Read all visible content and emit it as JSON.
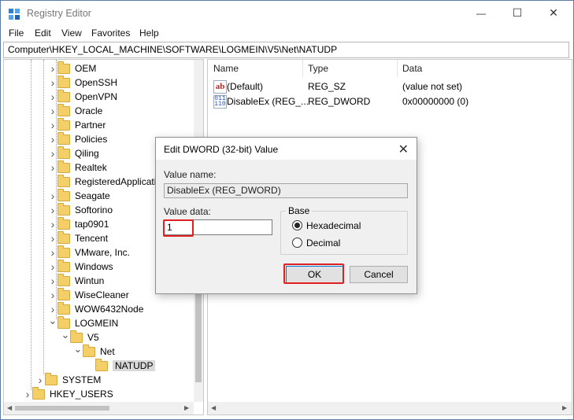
{
  "window": {
    "title": "Registry Editor",
    "icon": "registry-editor-icon",
    "controls": {
      "minimize": "—",
      "maximize": "☐",
      "close": "✕"
    }
  },
  "menu": [
    "File",
    "Edit",
    "View",
    "Favorites",
    "Help"
  ],
  "address": "Computer\\HKEY_LOCAL_MACHINE\\SOFTWARE\\LOGMEIN\\V5\\Net\\NATUDP",
  "tree": {
    "items": [
      {
        "label": "OEM",
        "expanded": false
      },
      {
        "label": "OpenSSH",
        "expanded": false
      },
      {
        "label": "OpenVPN",
        "expanded": false
      },
      {
        "label": "Oracle",
        "expanded": false
      },
      {
        "label": "Partner",
        "expanded": false
      },
      {
        "label": "Policies",
        "expanded": false
      },
      {
        "label": "Qiling",
        "expanded": false
      },
      {
        "label": "Realtek",
        "expanded": false
      },
      {
        "label": "RegisteredApplicati",
        "expanded": null
      },
      {
        "label": "Seagate",
        "expanded": false
      },
      {
        "label": "Softorino",
        "expanded": false
      },
      {
        "label": "tap0901",
        "expanded": false
      },
      {
        "label": "Tencent",
        "expanded": false
      },
      {
        "label": "VMware, Inc.",
        "expanded": false
      },
      {
        "label": "Windows",
        "expanded": false
      },
      {
        "label": "Wintun",
        "expanded": false
      },
      {
        "label": "WiseCleaner",
        "expanded": false
      },
      {
        "label": "WOW6432Node",
        "expanded": false
      },
      {
        "label": "LOGMEIN",
        "expanded": true
      },
      {
        "label": "V5",
        "expanded": true
      },
      {
        "label": "Net",
        "expanded": true
      },
      {
        "label": "NATUDP",
        "expanded": null,
        "selected": true
      },
      {
        "label": "SYSTEM",
        "expanded": false
      },
      {
        "label": "HKEY_USERS",
        "expanded": false
      }
    ]
  },
  "list": {
    "columns": [
      "Name",
      "Type",
      "Data"
    ],
    "rows": [
      {
        "icon": "string-value-icon",
        "name": "(Default)",
        "type": "REG_SZ",
        "data": "(value not set)"
      },
      {
        "icon": "binary-value-icon",
        "name": "DisableEx (REG_...",
        "type": "REG_DWORD",
        "data": "0x00000000 (0)"
      }
    ]
  },
  "dialog": {
    "title": "Edit DWORD (32-bit) Value",
    "value_name_label": "Value name:",
    "value_name": "DisableEx (REG_DWORD)",
    "value_data_label": "Value data:",
    "value_data": "1",
    "base_label": "Base",
    "base_options": [
      {
        "label": "Hexadecimal",
        "selected": true
      },
      {
        "label": "Decimal",
        "selected": false
      }
    ],
    "ok_label": "OK",
    "cancel_label": "Cancel",
    "close_glyph": "✕",
    "highlight_color": "#e02020"
  }
}
